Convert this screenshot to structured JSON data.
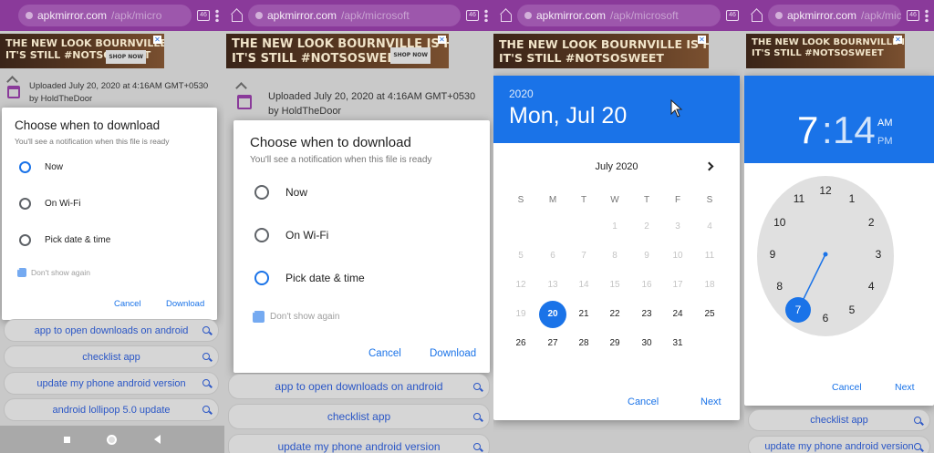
{
  "browser": {
    "host": "apkmirror.com",
    "paths": [
      "/apk/micro",
      "/apk/microsoft",
      "/apk/microsoft",
      "/apk/micro"
    ],
    "tab_count": "46"
  },
  "ad": {
    "line1": "THE NEW LOOK BOURNVILLE IS HERE",
    "line2": "IT'S STILL #NOTSOSWEET",
    "cta": "SHOP NOW",
    "close": "✕"
  },
  "upload": {
    "line1": "Uploaded July 20, 2020 at 4:16AM GMT+0530",
    "line2": "by HoldTheDoor"
  },
  "download_dialog": {
    "title": "Choose when to download",
    "subtitle": "You'll see a notification when this file is ready",
    "options": [
      "Now",
      "On Wi-Fi",
      "Pick date & time"
    ],
    "dont_show": "Don't show again",
    "cancel": "Cancel",
    "download": "Download",
    "selected_panel1": "Now",
    "selected_panel2": "Pick date & time"
  },
  "suggestions": [
    "app to open downloads on android",
    "checklist app",
    "update my phone android version",
    "android lollipop 5.0 update"
  ],
  "date_picker": {
    "year": "2020",
    "date": "Mon, Jul 20",
    "month": "July 2020",
    "weekdays": [
      "S",
      "M",
      "T",
      "W",
      "T",
      "F",
      "S"
    ],
    "weeks": [
      [
        "",
        "",
        "",
        "1",
        "2",
        "3",
        "4"
      ],
      [
        "5",
        "6",
        "7",
        "8",
        "9",
        "10",
        "11"
      ],
      [
        "12",
        "13",
        "14",
        "15",
        "16",
        "17",
        "18"
      ],
      [
        "19",
        "20",
        "21",
        "22",
        "23",
        "24",
        "25"
      ],
      [
        "26",
        "27",
        "28",
        "29",
        "30",
        "31",
        ""
      ]
    ],
    "selected_day": "20",
    "cancel": "Cancel",
    "next": "Next"
  },
  "time_picker": {
    "hour": "7",
    "separator": ":",
    "minute": "14",
    "am": "AM",
    "pm": "PM",
    "numbers": [
      "12",
      "1",
      "2",
      "3",
      "4",
      "5",
      "6",
      "7",
      "8",
      "9",
      "10",
      "11"
    ],
    "selected_hour": "7",
    "cancel": "Cancel",
    "next": "Next"
  },
  "colors": {
    "accent": "#1a73e8",
    "browser_bar": "#8a3a9a",
    "scrim": "#c9c9c9"
  }
}
